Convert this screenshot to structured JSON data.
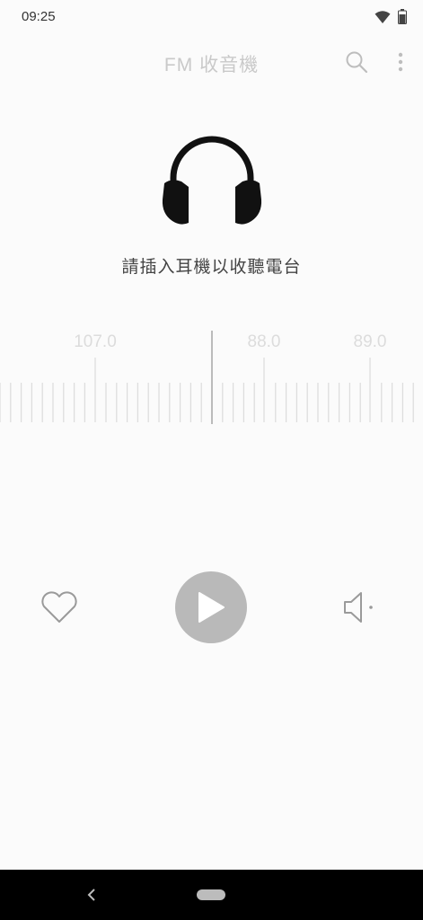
{
  "status_bar": {
    "time": "09:25",
    "icons": [
      "wifi-icon",
      "battery-icon"
    ]
  },
  "app_bar": {
    "title": "FM 收音機",
    "actions": [
      "search-icon",
      "more-vert-icon"
    ]
  },
  "hero": {
    "icon": "headphones-icon",
    "message": "請插入耳機以收聽電台"
  },
  "tuner": {
    "labels": [
      "107.0",
      "88.0",
      "89.0"
    ],
    "current_frequency": 87.6
  },
  "controls": {
    "favorite_icon": "heart-outline-icon",
    "play_icon": "play-icon",
    "speaker_icon": "speaker-icon"
  },
  "colors": {
    "title": "#c9c9c9",
    "play_button": "#b9b9b9",
    "tick": "#dddddd",
    "needle": "#bbbbbb",
    "nav_bar": "#000000"
  },
  "nav_bar": {
    "back_icon": "nav-back-icon",
    "home_icon": "nav-home-pill"
  }
}
